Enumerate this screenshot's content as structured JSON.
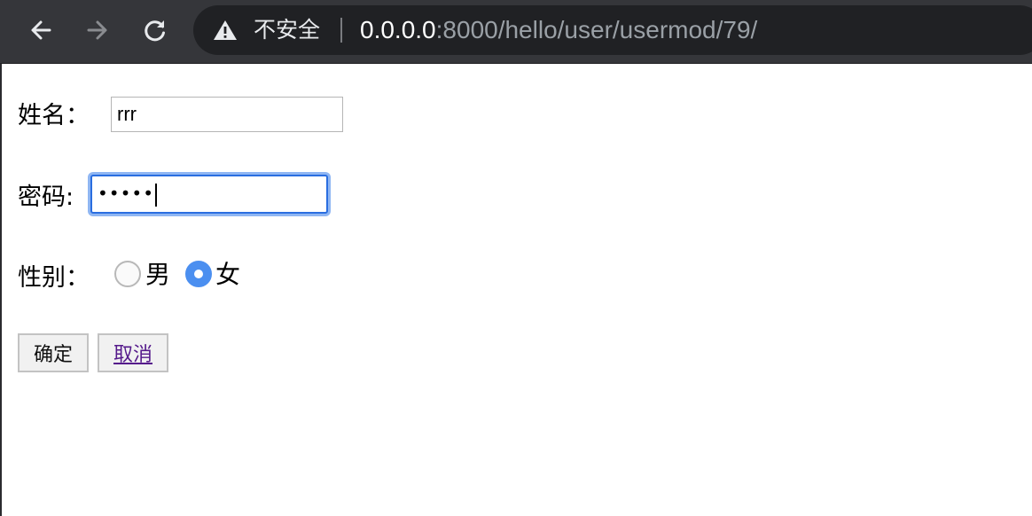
{
  "browser": {
    "insecure_label": "不安全",
    "url_host": "0.0.0.0",
    "url_rest": ":8000/hello/user/usermod/79/",
    "icons": {
      "back": "arrow-left-icon",
      "forward": "arrow-right-icon",
      "reload": "reload-icon",
      "warning": "warning-triangle-icon"
    },
    "colors": {
      "toolbar": "#35363a",
      "omnibox": "#202124"
    }
  },
  "form": {
    "name_label": "姓名：",
    "name_value": "rrr",
    "password_label": "密码:",
    "password_value": "•••••",
    "gender_label": "性别：",
    "gender_options": [
      {
        "label": "男",
        "checked": false
      },
      {
        "label": "女",
        "checked": true
      }
    ],
    "submit_label": "确定",
    "cancel_label": "取消",
    "colors": {
      "focus_ring": "#8fb6f3",
      "radio_checked": "#4b8ff0",
      "visited_link": "#551a8b"
    }
  }
}
